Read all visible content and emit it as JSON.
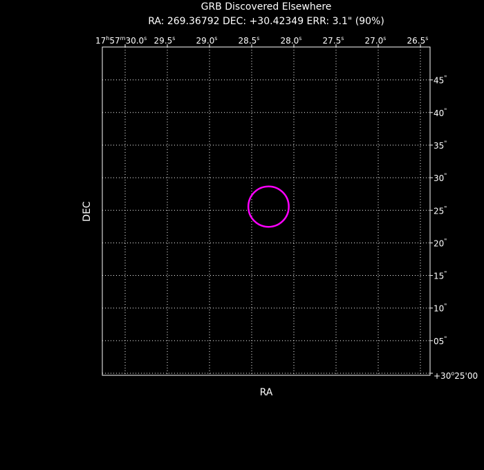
{
  "title": "GRB Discovered Elsewhere",
  "subtitle": "RA: 269.36792  DEC: +30.42349  ERR: 3.1\" (90%)",
  "x_axis_label": "RA",
  "y_axis_label": "DEC",
  "top_ticks": [
    {
      "text": "17h57m30.0s",
      "h": "17",
      "m": "57",
      "s": "30.0",
      "value_s": 30.0
    },
    {
      "text": "29.5s",
      "s": "29.5",
      "value_s": 29.5
    },
    {
      "text": "29.0s",
      "s": "29.0",
      "value_s": 29.0
    },
    {
      "text": "28.5s",
      "s": "28.5",
      "value_s": 28.5
    },
    {
      "text": "28.0s",
      "s": "28.0",
      "value_s": 28.0
    },
    {
      "text": "27.5s",
      "s": "27.5",
      "value_s": 27.5
    },
    {
      "text": "27.0s",
      "s": "27.0",
      "value_s": 27.0
    },
    {
      "text": "26.5s",
      "s": "26.5",
      "value_s": 26.5
    }
  ],
  "right_ticks": [
    {
      "text": "+30°25'00\"",
      "value_arcsec": 0,
      "prefix": "+30",
      "deg_tail": "25",
      "min_tail": "00"
    },
    {
      "text": "05\"",
      "num": "05",
      "value_arcsec": 5
    },
    {
      "text": "10\"",
      "num": "10",
      "value_arcsec": 10
    },
    {
      "text": "15\"",
      "num": "15",
      "value_arcsec": 15
    },
    {
      "text": "20\"",
      "num": "20",
      "value_arcsec": 20
    },
    {
      "text": "25\"",
      "num": "25",
      "value_arcsec": 25
    },
    {
      "text": "30\"",
      "num": "30",
      "value_arcsec": 30
    },
    {
      "text": "35\"",
      "num": "35",
      "value_arcsec": 35
    },
    {
      "text": "40\"",
      "num": "40",
      "value_arcsec": 40
    },
    {
      "text": "45\"",
      "num": "45",
      "value_arcsec": 45
    }
  ],
  "error_circle": {
    "ra_seconds": 28.3,
    "dec_arcsec_above_base": 25.56,
    "radius_arcsec": 3.1,
    "color": "#ff00ff"
  },
  "colors": {
    "background": "#000000",
    "foreground": "#ffffff",
    "circle": "#ff00ff"
  }
}
